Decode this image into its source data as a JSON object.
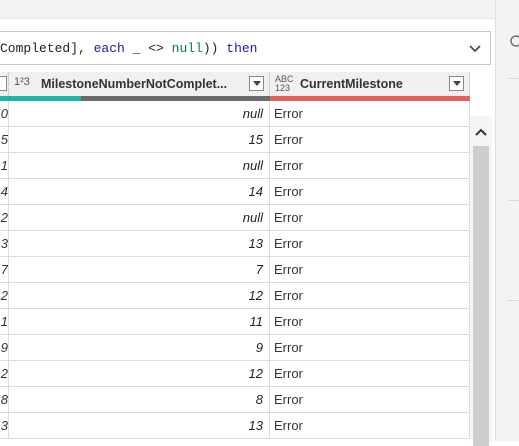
{
  "formula": {
    "prefix": "Completed], ",
    "kw_each": "each",
    "middle": " _ <> ",
    "null_word": "null",
    "close": ")) ",
    "kw_then": "then"
  },
  "columns": [
    {
      "type_label": "",
      "name": ""
    },
    {
      "type_label": "1²3",
      "name": "MilestoneNumberNotComplet..."
    },
    {
      "type_label": "ABC 123",
      "name": "CurrentMilestone"
    }
  ],
  "rows": [
    {
      "c0": "0",
      "c1": "null",
      "c2": "Error"
    },
    {
      "c0": "5",
      "c1": "15",
      "c2": "Error"
    },
    {
      "c0": "1",
      "c1": "null",
      "c2": "Error"
    },
    {
      "c0": "4",
      "c1": "14",
      "c2": "Error"
    },
    {
      "c0": "2",
      "c1": "null",
      "c2": "Error"
    },
    {
      "c0": "3",
      "c1": "13",
      "c2": "Error"
    },
    {
      "c0": "7",
      "c1": "7",
      "c2": "Error"
    },
    {
      "c0": "2",
      "c1": "12",
      "c2": "Error"
    },
    {
      "c0": "1",
      "c1": "11",
      "c2": "Error"
    },
    {
      "c0": "9",
      "c1": "9",
      "c2": "Error"
    },
    {
      "c0": "2",
      "c1": "12",
      "c2": "Error"
    },
    {
      "c0": "8",
      "c1": "8",
      "c2": "Error"
    },
    {
      "c0": "3",
      "c1": "13",
      "c2": "Error"
    }
  ],
  "colors": {
    "quality_valid": "#1fb5a4",
    "quality_empty": "#6b6b6b",
    "quality_error": "#e8605a"
  },
  "icons": {
    "expand": "chevron-down-icon",
    "scroll_up": "chevron-up-icon",
    "dropdown": "filter-dropdown-icon"
  }
}
